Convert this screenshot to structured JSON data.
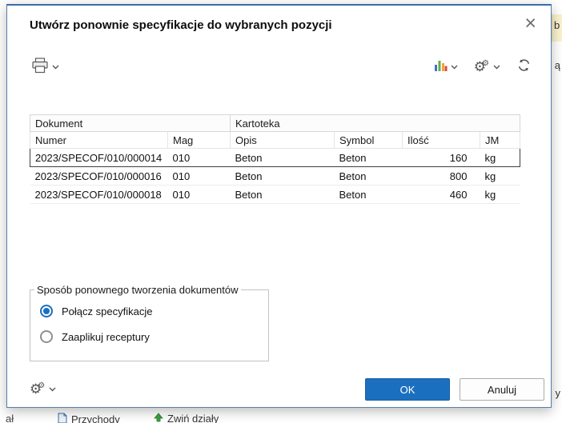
{
  "dialog": {
    "title": "Utwórz ponownie specyfikacje do wybranych pozycji",
    "close_glyph": "×"
  },
  "icons": {
    "printer": "printer-icon",
    "bar_chart": "bar-chart-icon",
    "gears": "gears-icon",
    "refresh": "refresh-icon",
    "chevron_down": "chevron-down-icon",
    "gear_glyph": "⚙"
  },
  "table": {
    "column_groups": [
      {
        "label": "Dokument",
        "span": 2
      },
      {
        "label": "Kartoteka",
        "span": 4
      }
    ],
    "columns": [
      "Numer",
      "Mag",
      "Opis",
      "Symbol",
      "Ilość",
      "JM"
    ],
    "rows": [
      {
        "numer": "2023/SPECOF/010/000014",
        "mag": "010",
        "opis": "Beton",
        "symbol": "Beton",
        "ilosc": "160",
        "jm": "kg",
        "selected": true
      },
      {
        "numer": "2023/SPECOF/010/000016",
        "mag": "010",
        "opis": "Beton",
        "symbol": "Beton",
        "ilosc": "800",
        "jm": "kg",
        "selected": false
      },
      {
        "numer": "2023/SPECOF/010/000018",
        "mag": "010",
        "opis": "Beton",
        "symbol": "Beton",
        "ilosc": "460",
        "jm": "kg",
        "selected": false
      }
    ]
  },
  "options_group": {
    "title": "Sposób ponownego tworzenia dokumentów",
    "options": [
      {
        "label": "Połącz specyfikacje",
        "selected": true
      },
      {
        "label": "Zaaplikuj receptury",
        "selected": false
      }
    ]
  },
  "footer": {
    "ok_label": "OK",
    "cancel_label": "Anuluj"
  },
  "colors": {
    "accent": "#1b6fbf",
    "selected_row_border": "#3f3f3f",
    "background_strip": "#faf2cd"
  },
  "background": {
    "top_right_fragment": "b",
    "right_fragment_1": "ą",
    "right_fragment_2": "y",
    "bottom_left_fragment": "ał",
    "bottom_items": [
      {
        "label": "Przychody"
      },
      {
        "label": "Zwiń działy"
      }
    ]
  }
}
